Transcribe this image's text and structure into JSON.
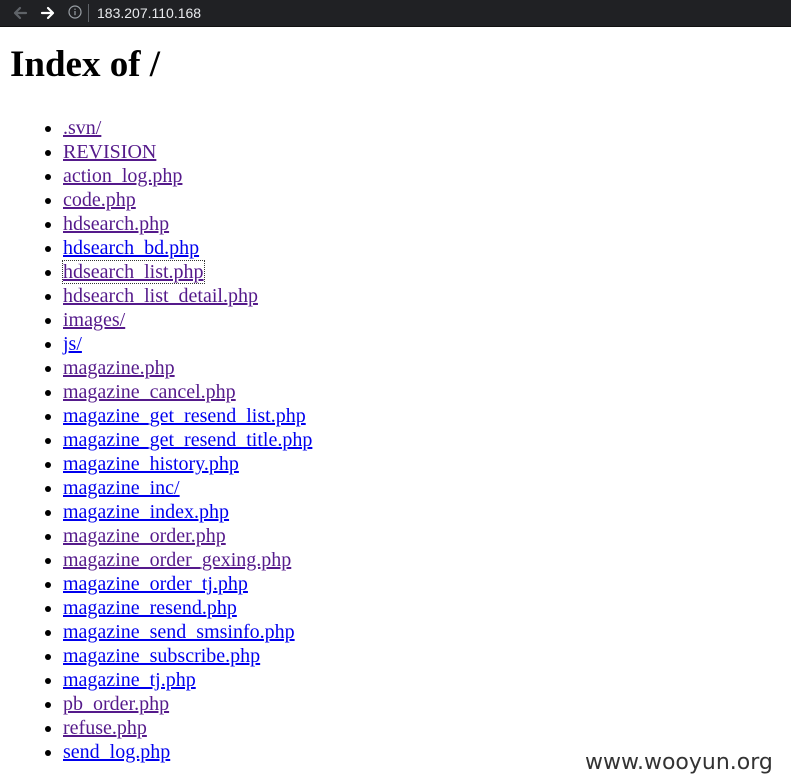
{
  "browser": {
    "address": "183.207.110.168"
  },
  "page": {
    "title": "Index of /",
    "entries": [
      {
        "label": ".svn/",
        "visited": true
      },
      {
        "label": "REVISION",
        "visited": true
      },
      {
        "label": "action_log.php",
        "visited": true
      },
      {
        "label": "code.php",
        "visited": true
      },
      {
        "label": "hdsearch.php",
        "visited": true
      },
      {
        "label": "hdsearch_bd.php",
        "visited": false
      },
      {
        "label": "hdsearch_list.php",
        "visited": true,
        "focused": true
      },
      {
        "label": "hdsearch_list_detail.php",
        "visited": true
      },
      {
        "label": "images/",
        "visited": true
      },
      {
        "label": "js/",
        "visited": false
      },
      {
        "label": "magazine.php",
        "visited": true
      },
      {
        "label": "magazine_cancel.php",
        "visited": true
      },
      {
        "label": "magazine_get_resend_list.php",
        "visited": false
      },
      {
        "label": "magazine_get_resend_title.php",
        "visited": false
      },
      {
        "label": "magazine_history.php",
        "visited": false
      },
      {
        "label": "magazine_inc/",
        "visited": false
      },
      {
        "label": "magazine_index.php",
        "visited": false
      },
      {
        "label": "magazine_order.php",
        "visited": true
      },
      {
        "label": "magazine_order_gexing.php",
        "visited": true
      },
      {
        "label": "magazine_order_tj.php",
        "visited": false
      },
      {
        "label": "magazine_resend.php",
        "visited": false
      },
      {
        "label": "magazine_send_smsinfo.php",
        "visited": false
      },
      {
        "label": "magazine_subscribe.php",
        "visited": false
      },
      {
        "label": "magazine_tj.php",
        "visited": false
      },
      {
        "label": "pb_order.php",
        "visited": true
      },
      {
        "label": "refuse.php",
        "visited": true
      },
      {
        "label": "send_log.php",
        "visited": false
      }
    ]
  },
  "watermark": "www.wooyun.org",
  "colors": {
    "link": "#0000ee",
    "visited": "#551a8b",
    "toolbar": "#202124"
  }
}
